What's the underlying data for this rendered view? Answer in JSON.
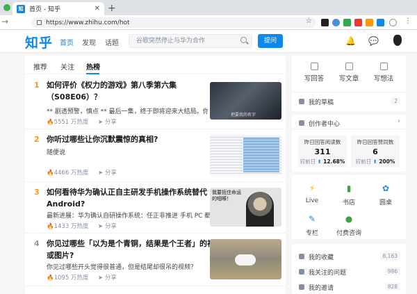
{
  "browser": {
    "tab_title": "首页 - 知乎",
    "favicon_text": "知",
    "url": "https://www.zhihu.com/hot",
    "close_glyph": "✕",
    "newtab_glyph": "+",
    "back_glyph": "→"
  },
  "header": {
    "logo": "知乎",
    "nav": [
      "首页",
      "发现",
      "话题"
    ],
    "search_placeholder": "谷歌突然停止与华为合作",
    "ask_label": "提问"
  },
  "feed": {
    "tabs": [
      "推荐",
      "关注",
      "热榜"
    ],
    "active_tab": "热榜",
    "share_label": "分享",
    "items": [
      {
        "rank": "1",
        "title": "如何评价《权力的游戏》第八季第六集（S08E06）？",
        "excerpt": "** 剧透预警，慎点 ** 最后一集，终于即将迎来大结局。你对...",
        "heat": "5551 万热度",
        "thumb_caption": "把要我的名字"
      },
      {
        "rank": "2",
        "title": "你听过哪些让你沉默震惊的真相?",
        "excerpt": "随便说",
        "heat": "4466 万热度"
      },
      {
        "rank": "3",
        "title": "如何看待华为确认正自主研发手机操作系统替代 Android?",
        "excerpt": "最新进展：华为确认自研操作系统：任正非推进 手机 PC 都...",
        "heat": "1433 万热度",
        "thumb_caption": "我要扼住命运的咽喉！"
      },
      {
        "rank": "4",
        "title": "你见过哪些「以为是个青铜，结果是个王者」的视频或图片?",
        "excerpt": "你见过哪些开头觉得很普通，但是结尾却很吊的视频？",
        "heat": "1095 万热度"
      }
    ]
  },
  "sidebar": {
    "actions": [
      "写回答",
      "写文章",
      "写想法"
    ],
    "drafts_label": "我的草稿",
    "drafts_count": "2",
    "creator_center": "创作者中心",
    "stats": [
      {
        "label": "昨日回答阅读数",
        "value": "311",
        "cmp_label": "较前日",
        "cmp_value": "12.68%"
      },
      {
        "label": "昨日回答赞同数",
        "value": "6",
        "cmp_label": "较前日",
        "cmp_value": "200%"
      }
    ],
    "grid": [
      "Live",
      "书店",
      "圆桌",
      "专栏",
      "付费咨询"
    ],
    "lists": [
      {
        "label": "我的收藏",
        "count": "8,163"
      },
      {
        "label": "我关注的问题",
        "count": "986"
      },
      {
        "label": "我的邀请",
        "count": "828"
      }
    ]
  },
  "colors": {
    "brand": "#0f88eb",
    "rank_top": "#ff9607",
    "rank_other": "#999999"
  }
}
